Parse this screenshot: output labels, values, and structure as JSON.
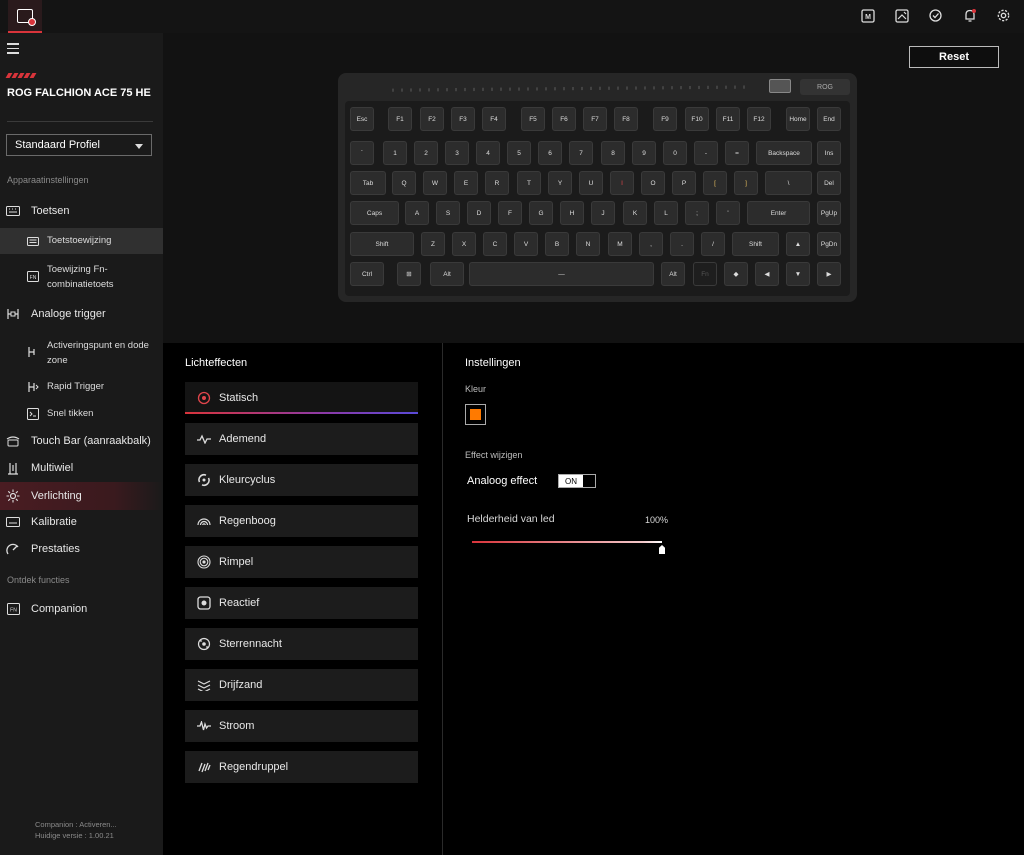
{
  "app": {
    "icon": "app-shield-icon"
  },
  "topbar_icons": [
    "macro-icon",
    "image-edit-icon",
    "sync-icon",
    "notification-icon",
    "settings-icon"
  ],
  "sidebar": {
    "device_name": "ROG FALCHION ACE 75 HE",
    "profile": "Standaard Profiel",
    "section_device": "Apparaatinstellingen",
    "items": [
      {
        "label": "Toetsen",
        "icon": "keyboard-icon"
      },
      {
        "label": "Toetstoewijzing",
        "icon": "keymap-icon"
      },
      {
        "label": "Toewijzing Fn-combinatietoets",
        "icon": "fn-key-icon"
      },
      {
        "label": "Analoge trigger",
        "icon": "analog-trigger-icon"
      },
      {
        "label": "Activeringspunt en dode zone",
        "icon": "actuation-icon"
      },
      {
        "label": "Rapid Trigger",
        "icon": "rapid-trigger-icon"
      },
      {
        "label": "Snel tikken",
        "icon": "quick-tap-icon"
      },
      {
        "label": "Touch Bar (aanraakbalk)",
        "icon": "touchbar-icon"
      },
      {
        "label": "Multiwiel",
        "icon": "multiwheel-icon"
      },
      {
        "label": "Verlichting",
        "icon": "lighting-icon"
      },
      {
        "label": "Kalibratie",
        "icon": "calibration-icon"
      },
      {
        "label": "Prestaties",
        "icon": "performance-icon"
      }
    ],
    "section_discover": "Ontdek functies",
    "companion": {
      "label": "Companion",
      "icon": "companion-icon"
    },
    "footer_line1": "Companion : Activeren...",
    "footer_line2": "Huidige versie : 1.00.21"
  },
  "toolbar": {
    "reset_label": "Reset"
  },
  "keyboard": {
    "logo_text": "ROG",
    "rows": [
      [
        "Esc",
        "F1",
        "F2",
        "F3",
        "F4",
        "F5",
        "F6",
        "F7",
        "F8",
        "F9",
        "F10",
        "F11",
        "F12",
        "Home",
        "End"
      ],
      [
        "`",
        "1",
        "2",
        "3",
        "4",
        "5",
        "6",
        "7",
        "8",
        "9",
        "0",
        "-",
        "=",
        "Backspace",
        "Ins"
      ],
      [
        "Tab",
        "Q",
        "W",
        "E",
        "R",
        "T",
        "Y",
        "U",
        "I",
        "O",
        "P",
        "[",
        "]",
        "\\",
        "Del"
      ],
      [
        "Caps",
        "A",
        "S",
        "D",
        "F",
        "G",
        "H",
        "J",
        "K",
        "L",
        ";",
        "'",
        "Enter",
        "PgUp"
      ],
      [
        "Shift",
        "Z",
        "X",
        "C",
        "V",
        "B",
        "N",
        "M",
        ",",
        ".",
        "/",
        "Shift",
        "▲",
        "PgDn"
      ],
      [
        "Ctrl",
        "⊞",
        "Alt",
        "—",
        "Alt",
        "Fn",
        "◆",
        "◀",
        "▼",
        "▶"
      ]
    ]
  },
  "effects": {
    "title": "Lichteffecten",
    "active_index": 0,
    "items": [
      {
        "label": "Statisch",
        "icon": "static-icon"
      },
      {
        "label": "Ademend",
        "icon": "breathing-icon"
      },
      {
        "label": "Kleurcyclus",
        "icon": "color-cycle-icon"
      },
      {
        "label": "Regenboog",
        "icon": "rainbow-icon"
      },
      {
        "label": "Rimpel",
        "icon": "ripple-icon"
      },
      {
        "label": "Reactief",
        "icon": "reactive-icon"
      },
      {
        "label": "Sterrennacht",
        "icon": "starry-night-icon"
      },
      {
        "label": "Drijfzand",
        "icon": "quicksand-icon"
      },
      {
        "label": "Stroom",
        "icon": "current-icon"
      },
      {
        "label": "Regendruppel",
        "icon": "raindrop-icon"
      }
    ]
  },
  "settings": {
    "title": "Instellingen",
    "color_label": "Kleur",
    "color_value": "#ff7a00",
    "effect_change_label": "Effect wijzigen",
    "analog_effect_label": "Analoog effect",
    "analog_effect_state": "ON",
    "brightness_label": "Helderheid van led",
    "brightness_value": "100%",
    "brightness_fraction": 1.0
  },
  "colors": {
    "accent": "#d9343b",
    "swatch": "#ff7a00"
  }
}
